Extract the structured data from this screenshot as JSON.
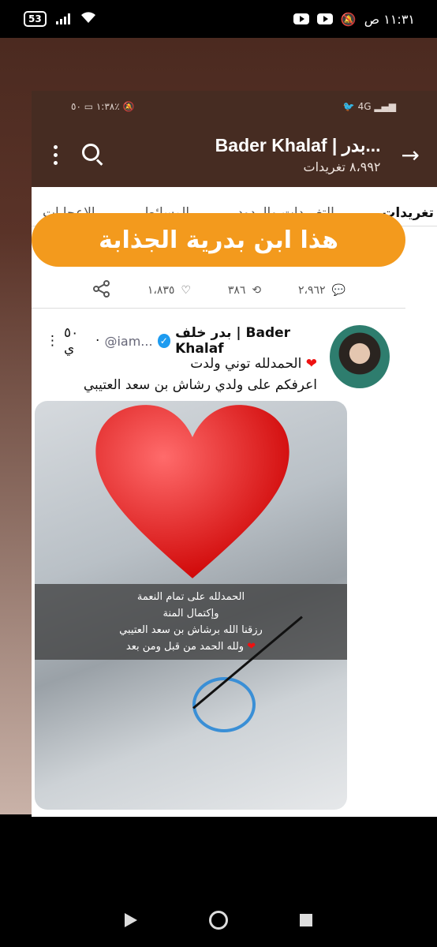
{
  "status_bar": {
    "battery": "53",
    "time": "١١:٣١ ص"
  },
  "inner_status": {
    "time": "١:٣٨",
    "battery": "٥٠٪",
    "network": "4G"
  },
  "header": {
    "title": "Bader Khalaf | بدر...",
    "subtitle": "٨،٩٩٢ تغريدات"
  },
  "tabs": [
    {
      "label": "تغريدات",
      "active": true
    },
    {
      "label": "التغريدات والردود",
      "active": false
    },
    {
      "label": "الوسائط",
      "active": false
    },
    {
      "label": "الإعجابات",
      "active": false
    }
  ],
  "banner": {
    "text": "هذا ابن بدرية الجذابة"
  },
  "actions": {
    "replies": "٢،٩٦٢",
    "retweets": "٣٨٦",
    "likes": "١،٨٣٥"
  },
  "tweet": {
    "name": "بدر خلف | Bader Khalaf",
    "handle": "@iam...",
    "time": "٥٠ ي",
    "line1": "الحمدلله توني ولدت",
    "line2": "اعرفكم على ولدي رشاش بن سعد العتيبي",
    "caption_lines": [
      "الحمدلله على تمام النعمة",
      "وإكتمال المنة",
      "رزقنا الله برشاش بن سعد العتيبي",
      "ولله الحمد من قبل ومن بعد"
    ]
  },
  "colors": {
    "header_bg": "#462c22",
    "banner_bg": "#f39a1d",
    "verified": "#1d9bf0"
  }
}
